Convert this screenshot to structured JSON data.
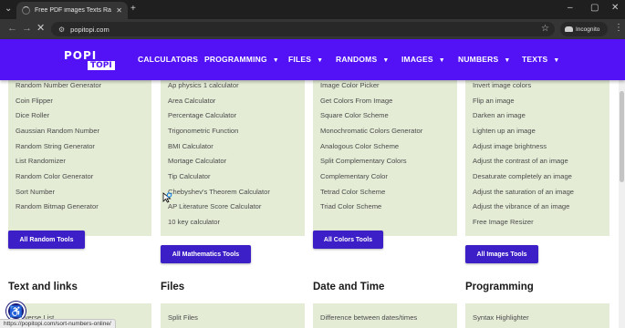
{
  "browser": {
    "tab_title": "Free PDF images Texts Random",
    "url": "popitopi.com",
    "incognito_label": "Incognito",
    "status_url": "https://popitopi.com/sort-numbers-online/"
  },
  "site": {
    "logo_top": "POPI",
    "logo_bottom": "TOPI",
    "nav": [
      "CALCULATORS",
      "PROGRAMMING",
      "FILES",
      "RANDOMS",
      "IMAGES",
      "NUMBERS",
      "TEXTS"
    ]
  },
  "panels": {
    "random": [
      "Random Number Generator",
      "Coin Flipper",
      "Dice Roller",
      "Gaussian Random Number",
      "Random String Generator",
      "List Randomizer",
      "Random Color Generator",
      "Sort Number",
      "Random Bitmap Generator"
    ],
    "math": [
      "Ap physics 1 calculator",
      "Area Calculator",
      "Percentage Calculator",
      "Trigonometric Function",
      "BMI Calculator",
      "Mortage Calculator",
      "Tip Calculator",
      "Chebyshev's Theorem Calculator",
      "AP Literature Score Calculator",
      "10 key calculator"
    ],
    "colors": [
      "Image Color Picker",
      "Get Colors From Image",
      "Square Color Scheme",
      "Monochromatic Colors Generator",
      "Analogous Color Scheme",
      "Split Complementary Colors",
      "Complementary Color",
      "Tetrad Color Scheme",
      "Triad Color Scheme"
    ],
    "images": [
      "Invert image colors",
      "Flip an image",
      "Darken an image",
      "Lighten up an image",
      "Adjust image brightness",
      "Adjust the contrast of an image",
      "Desaturate completely an image",
      "Adjust the saturation of an image",
      "Adjust the vibrance of an image",
      "Free Image Resizer"
    ]
  },
  "buttons": {
    "random": "All Random Tools",
    "math": "All Mathematics Tools",
    "colors": "All Colors Tools",
    "images": "All Images Tools"
  },
  "sections": {
    "text_links": {
      "title": "Text and links",
      "first_item": "Reverse List"
    },
    "files": {
      "title": "Files",
      "first_item": "Split Files"
    },
    "date_time": {
      "title": "Date and Time",
      "first_item": "Difference between dates/times"
    },
    "programming": {
      "title": "Programming",
      "first_item": "Syntax Highlighter"
    }
  },
  "colors": {
    "header": "#5212f5",
    "button": "#3c1fc6",
    "panel": "#e4ecd6"
  }
}
